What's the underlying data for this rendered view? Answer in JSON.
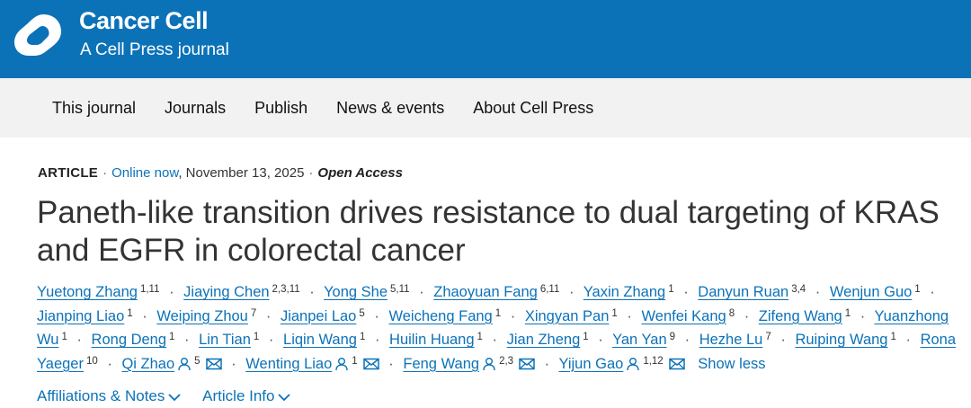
{
  "brand": {
    "title": "Cancer Cell",
    "subtitle": "A Cell Press journal",
    "color": "#0c72b8"
  },
  "nav": [
    "This journal",
    "Journals",
    "Publish",
    "News & events",
    "About Cell Press"
  ],
  "article": {
    "type": "ARTICLE",
    "online": "Online now",
    "date": ", November 13, 2025",
    "access": "Open Access",
    "title": "Paneth-like transition drives resistance to dual targeting of KRAS and EGFR in colorectal cancer"
  },
  "authors": [
    {
      "name": "Yuetong Zhang",
      "sup": "1,11"
    },
    {
      "name": "Jiaying Chen",
      "sup": "2,3,11"
    },
    {
      "name": "Yong She",
      "sup": "5,11"
    },
    {
      "name": "Zhaoyuan Fang",
      "sup": "6,11"
    },
    {
      "name": "Yaxin Zhang",
      "sup": "1"
    },
    {
      "name": "Danyun Ruan",
      "sup": "3,4"
    },
    {
      "name": "Wenjun Guo",
      "sup": "1"
    },
    {
      "name": "Jianping Liao",
      "sup": "1"
    },
    {
      "name": "Weiping Zhou",
      "sup": "7"
    },
    {
      "name": "Jianpei Lao",
      "sup": "5"
    },
    {
      "name": "Weicheng Fang",
      "sup": "1"
    },
    {
      "name": "Xingyan Pan",
      "sup": "1"
    },
    {
      "name": "Wenfei Kang",
      "sup": "8"
    },
    {
      "name": "Zifeng Wang",
      "sup": "1"
    },
    {
      "name": "Yuanzhong Wu",
      "sup": "1"
    },
    {
      "name": "Rong Deng",
      "sup": "1"
    },
    {
      "name": "Lin Tian",
      "sup": "1"
    },
    {
      "name": "Liqin Wang",
      "sup": "1"
    },
    {
      "name": "Huilin Huang",
      "sup": "1"
    },
    {
      "name": "Jian Zheng",
      "sup": "1"
    },
    {
      "name": "Yan Yan",
      "sup": "9"
    },
    {
      "name": "Hezhe Lu",
      "sup": "7"
    },
    {
      "name": "Ruiping Wang",
      "sup": "1"
    },
    {
      "name": "Rona Yaeger",
      "sup": "10"
    },
    {
      "name": "Qi Zhao",
      "sup": "5",
      "contact": true
    },
    {
      "name": "Wenting Liao",
      "sup": "1",
      "contact": true
    },
    {
      "name": "Feng Wang",
      "sup": "2,3",
      "contact": true
    },
    {
      "name": "Yijun Gao",
      "sup": "1,12",
      "contact": true
    }
  ],
  "show_less": "Show less",
  "links": {
    "affiliations": "Affiliations & Notes",
    "article_info": "Article Info"
  },
  "icons": {
    "contact": "person-icon",
    "email": "envelope-icon",
    "expand": "chevron-down-icon"
  }
}
